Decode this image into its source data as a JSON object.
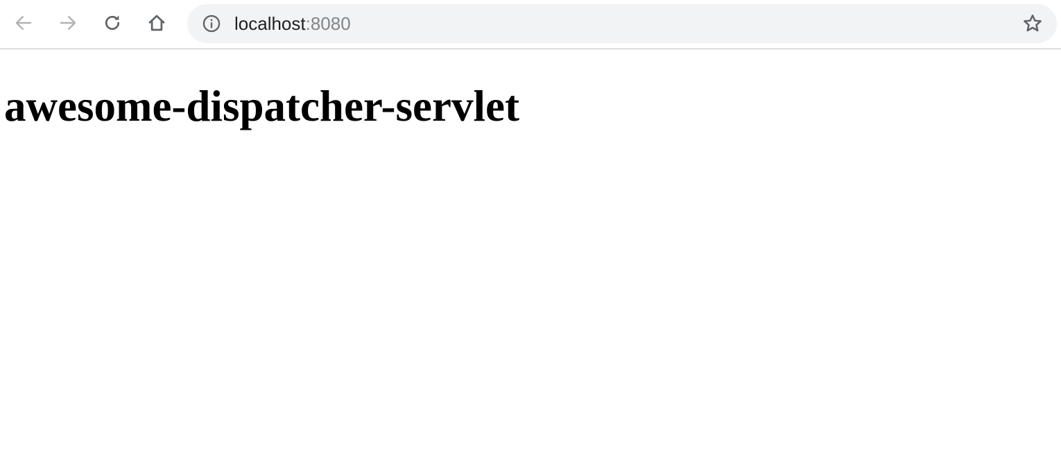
{
  "browser": {
    "address_bar": {
      "host": "localhost",
      "port": ":8080"
    },
    "icons": {
      "back": "back-arrow-icon",
      "forward": "forward-arrow-icon",
      "reload": "reload-icon",
      "home": "home-icon",
      "site_info": "info-icon",
      "bookmark": "star-icon"
    },
    "colors": {
      "toolbar_bg": "#ffffff",
      "omnibox_bg": "#f1f3f4",
      "icon_active": "#5f6368",
      "icon_disabled": "#b0b3b8",
      "port_text": "#80868b"
    }
  },
  "page": {
    "heading": "awesome-dispatcher-servlet"
  }
}
